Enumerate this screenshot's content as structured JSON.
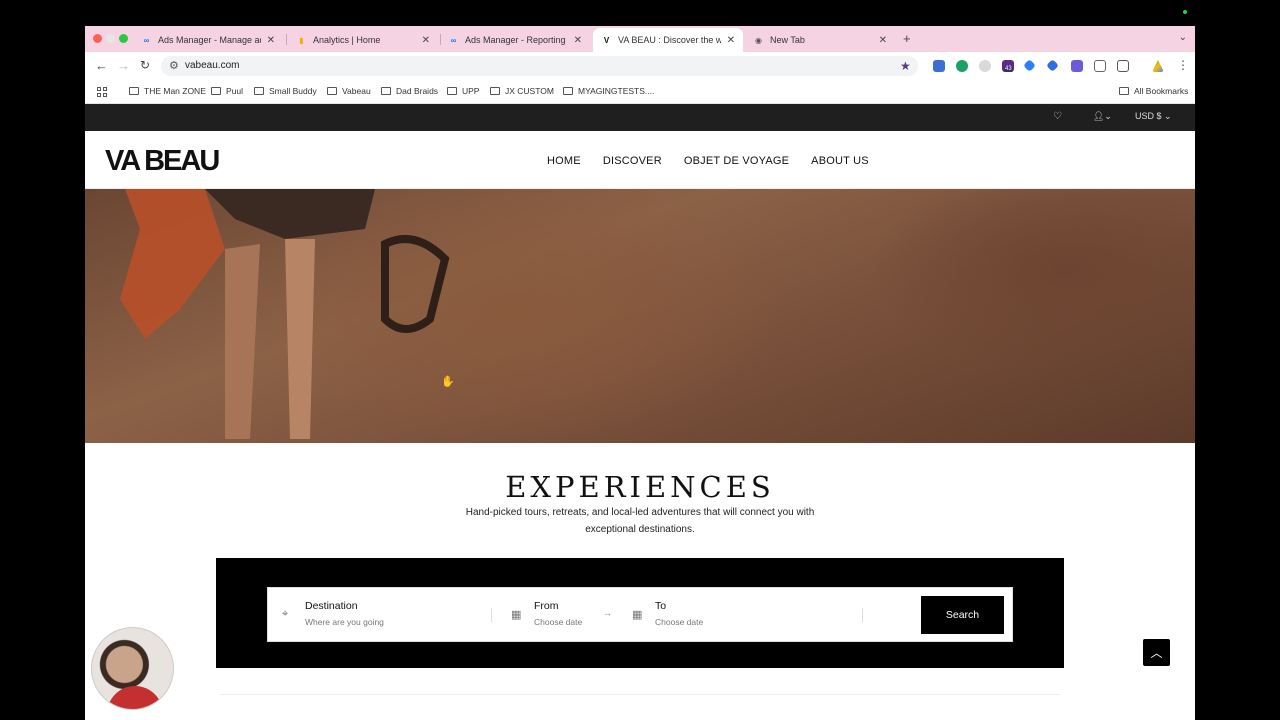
{
  "browser": {
    "tabs": [
      {
        "label": "Ads Manager - Manage ads -",
        "icon": "meta-icon"
      },
      {
        "label": "Analytics | Home",
        "icon": "analytics-icon"
      },
      {
        "label": "Ads Manager - Reporting - V",
        "icon": "meta-icon"
      },
      {
        "label": "VA BEAU : Discover the world",
        "icon": "vabeau-icon"
      },
      {
        "label": "New Tab",
        "icon": "chrome-icon"
      }
    ],
    "url": "vabeau.com",
    "bookmarks": [
      "THE Man ZONE",
      "Puul",
      "Small Buddy",
      "Vabeau",
      "Dad Braids",
      "UPP",
      "JX CUSTOM",
      "MYAGINGTESTS...."
    ],
    "all_bookmarks": "All Bookmarks",
    "extension_badge": "43"
  },
  "site": {
    "currency": "USD $",
    "logo": "VA BEAU",
    "nav": [
      "HOME",
      "DISCOVER",
      "OBJET DE VOYAGE",
      "ABOUT US"
    ],
    "experiences_title": "EXPERIENCES",
    "experiences_subtitle": "Hand-picked tours, retreats, and local-led adventures that will connect you with exceptional destinations.",
    "search": {
      "destination_label": "Destination",
      "destination_placeholder": "Where are you going",
      "from_label": "From",
      "from_placeholder": "Choose date",
      "to_label": "To",
      "to_placeholder": "Choose date",
      "button": "Search"
    }
  },
  "colors": {
    "tabstrip": "#f6d3e3",
    "topbar": "#1f1f1f",
    "search_band": "#000000"
  }
}
